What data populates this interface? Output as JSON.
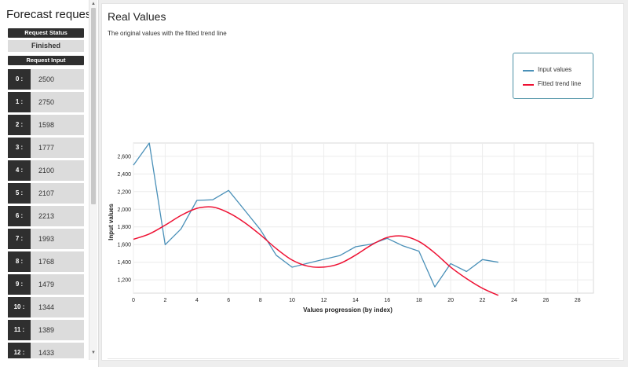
{
  "sidebar": {
    "title": "Forecast request",
    "status_label": "Request Status",
    "status_value": "Finished",
    "input_label": "Request Input",
    "inputs": [
      {
        "index": "0 :",
        "value": "2500"
      },
      {
        "index": "1 :",
        "value": "2750"
      },
      {
        "index": "2 :",
        "value": "1598"
      },
      {
        "index": "3 :",
        "value": "1777"
      },
      {
        "index": "4 :",
        "value": "2100"
      },
      {
        "index": "5 :",
        "value": "2107"
      },
      {
        "index": "6 :",
        "value": "2213"
      },
      {
        "index": "7 :",
        "value": "1993"
      },
      {
        "index": "8 :",
        "value": "1768"
      },
      {
        "index": "9 :",
        "value": "1479"
      },
      {
        "index": "10 :",
        "value": "1344"
      },
      {
        "index": "11 :",
        "value": "1389"
      },
      {
        "index": "12 :",
        "value": "1433"
      }
    ],
    "scroll_up_glyph": "▲",
    "scroll_down_glyph": "▼"
  },
  "main": {
    "title": "Real Values",
    "subtitle": "The original values with the fitted trend line"
  },
  "chart_data": {
    "type": "line",
    "xlabel": "Values progression (by index)",
    "ylabel": "Input values",
    "xlim": [
      0,
      29
    ],
    "ylim": [
      1050,
      2750
    ],
    "x_ticks": [
      0,
      2,
      4,
      6,
      8,
      10,
      12,
      14,
      16,
      18,
      20,
      22,
      24,
      26,
      28
    ],
    "y_ticks": [
      1200,
      1400,
      1600,
      1800,
      2000,
      2200,
      2400,
      2600
    ],
    "y_tick_labels": [
      "1,200",
      "1,400",
      "1,600",
      "1,800",
      "2,000",
      "2,200",
      "2,400",
      "2,600"
    ],
    "grid": true,
    "legend_position": "top-right",
    "series": [
      {
        "name": "Input values",
        "color": "#4a90b8",
        "x": [
          0,
          1,
          2,
          3,
          4,
          5,
          6,
          7,
          8,
          9,
          10,
          11,
          12,
          13,
          14,
          15,
          16,
          17,
          18,
          19,
          20,
          21,
          22,
          23
        ],
        "values": [
          2500,
          2750,
          1598,
          1777,
          2100,
          2107,
          2213,
          1993,
          1768,
          1479,
          1344,
          1389,
          1433,
          1475,
          1575,
          1605,
          1670,
          1585,
          1525,
          1120,
          1385,
          1295,
          1430,
          1400
        ]
      },
      {
        "name": "Fitted trend line",
        "color": "#ee1133",
        "x": [
          0,
          1,
          2,
          3,
          4,
          5,
          6,
          7,
          8,
          9,
          10,
          11,
          12,
          13,
          14,
          15,
          16,
          17,
          18,
          19,
          20,
          21,
          22,
          23
        ],
        "values": [
          1660,
          1720,
          1820,
          1930,
          2010,
          2025,
          1960,
          1850,
          1710,
          1555,
          1425,
          1355,
          1345,
          1385,
          1480,
          1595,
          1680,
          1695,
          1635,
          1505,
          1345,
          1215,
          1105,
          1025
        ]
      }
    ]
  }
}
